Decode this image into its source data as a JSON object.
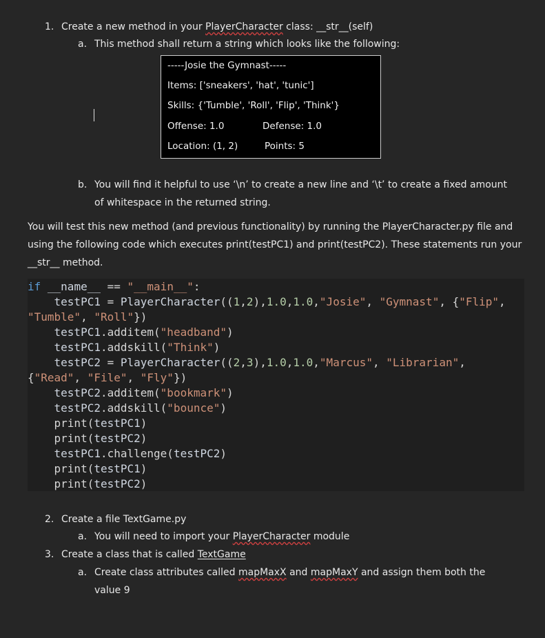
{
  "item1": {
    "num": "1.",
    "text_before": "Create a new method in your ",
    "class_name": "PlayerCharacter",
    "text_after": " class: __str__(self)"
  },
  "item1a": {
    "num": "a.",
    "text": "This method shall return a string which looks like the following:"
  },
  "sample_output": {
    "line1": "-----Josie the Gymnast-----",
    "line2": "Items: ['sneakers', 'hat', 'tunic']",
    "line3": "Skills: {'Tumble', 'Roll', 'Flip', 'Think'}",
    "offense": "Offense: 1.0",
    "defense": "Defense: 1.0",
    "location": "Location: (1, 2)",
    "points": "Points: 5"
  },
  "item1b": {
    "num": "b.",
    "line1": "You will find it helpful to use ‘\\n’ to create a new line and ‘\\t’ to create a fixed amount",
    "line2": "of whitespace in the returned string."
  },
  "para": {
    "line1": "You will test this new method (and previous functionality) by running the PlayerCharacter.py file and",
    "line2": "using the following code which executes print(testPC1) and print(testPC2).  These statements run your",
    "line3": "__str__ method."
  },
  "item2": {
    "num": "2.",
    "text": "Create a file TextGame.py"
  },
  "item2a": {
    "num": "a.",
    "text_before": "You will need to import your ",
    "module": "PlayerCharacter",
    "text_after": " module"
  },
  "item3": {
    "num": "3.",
    "text_before": "Create a class that is called ",
    "class_name": "TextGame"
  },
  "item3a": {
    "num": "a.",
    "text_before": "Create class attributes called ",
    "attr1": "mapMaxX",
    "mid": " and ",
    "attr2": "mapMaxY",
    "text_after": " and assign them both the",
    "line2": "value 9"
  }
}
